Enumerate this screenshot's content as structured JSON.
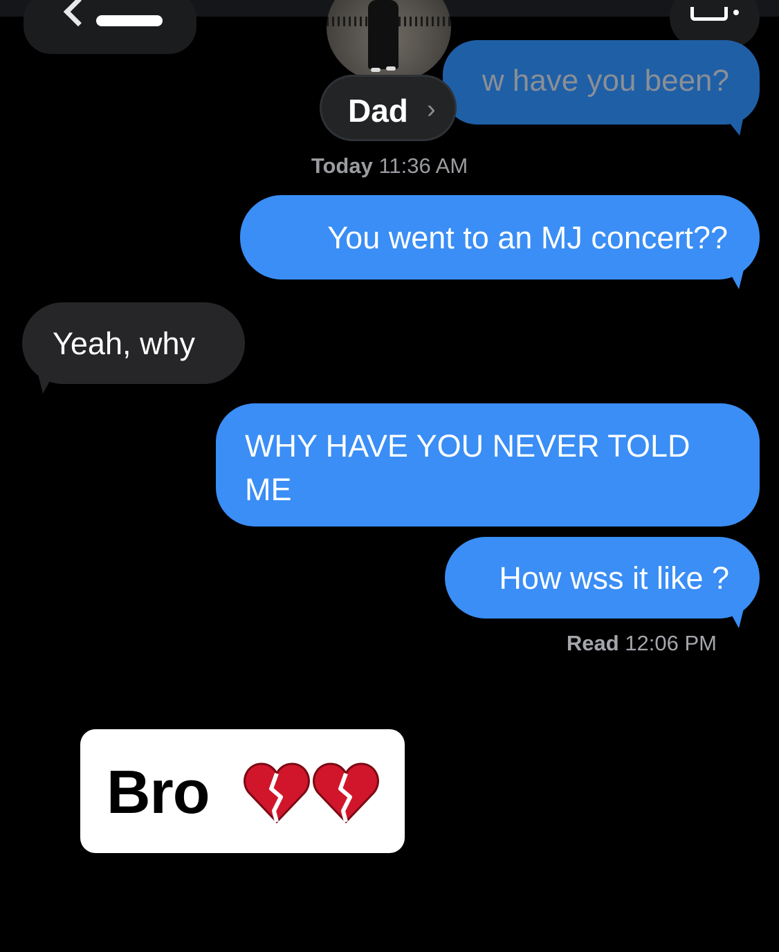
{
  "header": {
    "contact_name": "Dad",
    "contact_chevron": "›"
  },
  "previous_message": {
    "text": "w have you been?"
  },
  "conversation": {
    "timestamp_day": "Today",
    "timestamp_time": "11:36 AM",
    "messages": [
      {
        "side": "outgoing",
        "text": "You went to an MJ concert??"
      },
      {
        "side": "incoming",
        "text": "Yeah, why"
      },
      {
        "side": "outgoing",
        "text": "WHY HAVE YOU NEVER TOLD ME"
      },
      {
        "side": "outgoing",
        "text": "How wss it like ?"
      }
    ],
    "read_label": "Read",
    "read_time": "12:06 PM"
  },
  "sticker": {
    "text": "Bro",
    "emoji": "broken-heart-icon x2"
  },
  "colors": {
    "outgoing_bubble": "#3a8ef5",
    "incoming_bubble": "#262628",
    "background": "#000000"
  }
}
